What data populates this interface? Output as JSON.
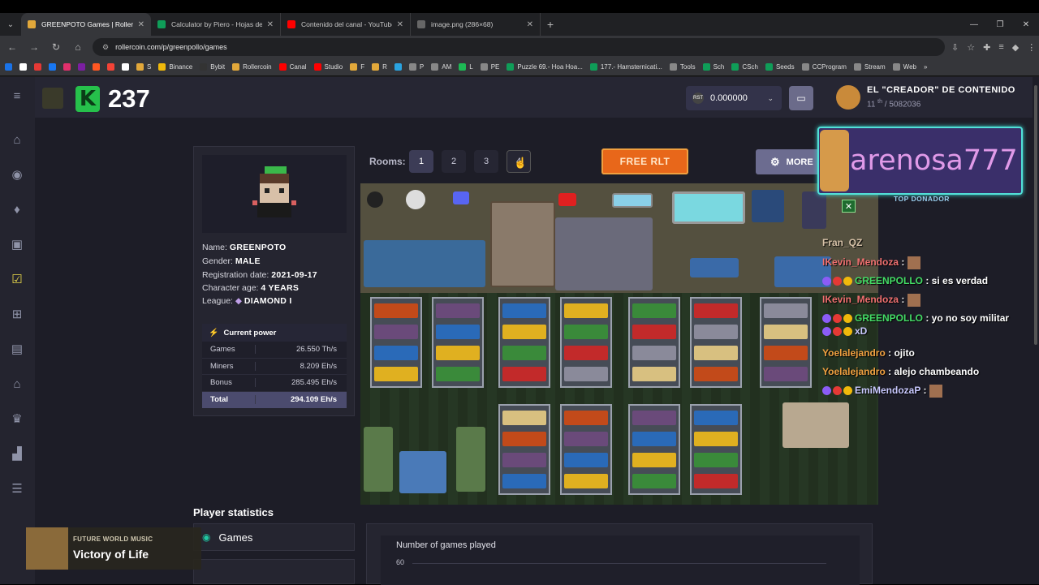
{
  "browser": {
    "tabs": [
      {
        "label": "GREENPOTO Games | Rollercoin",
        "color": "#e2a83a",
        "active": true
      },
      {
        "label": "Calculator by Piero - Hojas de c",
        "color": "#0f9d58",
        "active": false
      },
      {
        "label": "Contenido del canal - YouTube",
        "color": "#ff0000",
        "active": false
      },
      {
        "label": "image.png (286×68)",
        "color": "#666666",
        "active": false
      }
    ],
    "new_tab": "+",
    "url": "rollercoin.com/p/greenpollo/games",
    "bookmarks": [
      {
        "label": "",
        "color": "#1a73e8"
      },
      {
        "label": "",
        "color": "#ffffff"
      },
      {
        "label": "",
        "color": "#e53935"
      },
      {
        "label": "",
        "color": "#1877f2"
      },
      {
        "label": "",
        "color": "#e1306c"
      },
      {
        "label": "",
        "color": "#7b1fa2"
      },
      {
        "label": "",
        "color": "#ff5722"
      },
      {
        "label": "",
        "color": "#f44336"
      },
      {
        "label": "",
        "color": "#ffffff"
      },
      {
        "label": "S",
        "color": "#e2a83a"
      },
      {
        "label": "Binance",
        "color": "#f0b90b"
      },
      {
        "label": "Bybit",
        "color": "#333333"
      },
      {
        "label": "Rollercoin",
        "color": "#e2a83a"
      },
      {
        "label": "Canal",
        "color": "#ff0000"
      },
      {
        "label": "Studio",
        "color": "#ff0000"
      },
      {
        "label": "F",
        "color": "#e2a83a"
      },
      {
        "label": "R",
        "color": "#e2a83a"
      },
      {
        "label": "",
        "color": "#2aa3e0"
      },
      {
        "label": "P",
        "color": "#888888"
      },
      {
        "label": "AM",
        "color": "#888888"
      },
      {
        "label": "L",
        "color": "#1db954"
      },
      {
        "label": "PE",
        "color": "#888888"
      },
      {
        "label": "Puzzle 69.- Hoa Hoa...",
        "color": "#0f9d58"
      },
      {
        "label": "177.- Hamsternicati...",
        "color": "#0f9d58"
      },
      {
        "label": "Tools",
        "color": "#888888"
      },
      {
        "label": "Sch",
        "color": "#0f9d58"
      },
      {
        "label": "CSch",
        "color": "#0f9d58"
      },
      {
        "label": "Seeds",
        "color": "#0f9d58"
      },
      {
        "label": "CCProgram",
        "color": "#888888"
      },
      {
        "label": "Stream",
        "color": "#888888"
      },
      {
        "label": "Web",
        "color": "#888888"
      }
    ],
    "more_bookmarks": "»"
  },
  "header": {
    "k_logo": "K",
    "k_count": "237",
    "balance": "0.000000",
    "balance_icon": "RST",
    "user_name": "EL \"CREADOR\" DE CONTENIDO",
    "user_rank_pos": "11",
    "user_rank_sup": "th",
    "user_rank_total": "/ 5082036"
  },
  "profile": {
    "name_label": "Name:",
    "name": "GREENPOTO",
    "gender_label": "Gender:",
    "gender": "MALE",
    "reg_label": "Registration date:",
    "reg_date": "2021-09-17",
    "age_label": "Character age:",
    "age": "4 YEARS",
    "league_label": "League:",
    "league": "DIAMOND I",
    "power_title": "Current power",
    "power_rows": [
      {
        "label": "Games",
        "value": "26.550 Th/s"
      },
      {
        "label": "Miners",
        "value": "8.209 Eh/s"
      },
      {
        "label": "Bonus",
        "value": "285.495 Eh/s"
      },
      {
        "label": "Total",
        "value": "294.109 Eh/s"
      }
    ]
  },
  "rooms": {
    "label": "Rooms:",
    "buttons": [
      "1",
      "2",
      "3",
      "4"
    ],
    "free_rlt": "FREE RLT",
    "more": "MORE"
  },
  "overlay": {
    "donor_name": "arenosa777",
    "donor_tag": "TOP DONADOR",
    "close": "✕",
    "chat": [
      {
        "user": "Fran_QZ",
        "msg": "",
        "ucls": "u1"
      },
      {
        "user": "IKevin_Mendoza",
        "msg": " :",
        "ucls": "u2"
      },
      {
        "user": "GREENPOLLO",
        "msg": " : si es verdad",
        "ucls": "u3"
      },
      {
        "user": "IKevin_Mendoza",
        "msg": " :",
        "ucls": "u2"
      },
      {
        "user": "GREENPOLLO",
        "msg": " : yo no soy militar",
        "ucls": "u3"
      },
      {
        "user": "xD",
        "msg": "",
        "ucls": "u5"
      },
      {
        "user": "Yoelalejandro",
        "msg": " : ojito",
        "ucls": "u4"
      },
      {
        "user": "Yoelalejandro",
        "msg": " : alejo chambeando",
        "ucls": "u4"
      },
      {
        "user": "EmiMendozaP",
        "msg": " :",
        "ucls": "u5"
      }
    ]
  },
  "stats": {
    "title": "Player statistics",
    "games_tab": "Games",
    "chart_title": "Number of games played",
    "chart_tick": "60"
  },
  "music": {
    "subtitle": "FUTURE WORLD MUSIC",
    "title": "Victory of Life"
  },
  "colors": {
    "accent_green": "#26c04b",
    "free_rlt": "#e8671a",
    "total_row": "#4b4b6e",
    "power_icon": "#21c6a1"
  }
}
